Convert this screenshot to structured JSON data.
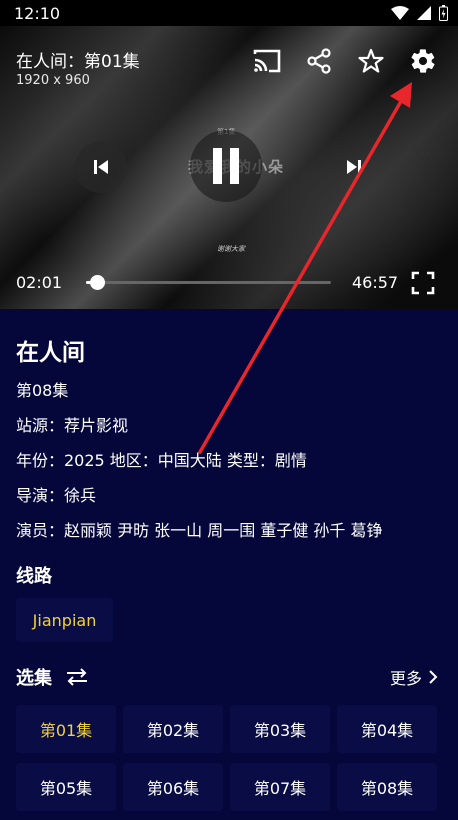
{
  "status": {
    "time": "12:10"
  },
  "player": {
    "title": "在人间：第01集",
    "resolution": "1920 x 960",
    "current_time": "02:01",
    "total_time": "46:57",
    "progress_fraction": 0.043,
    "frame_caption_top": "第1集",
    "frame_caption_main": "我爱我的小朵",
    "frame_caption_bottom": "谢谢大家"
  },
  "show": {
    "title": "在人间",
    "episode": "第08集",
    "source": "站源：荐片影视",
    "meta": "年份：2025  地区：中国大陆  类型：剧情",
    "director": "导演：徐兵",
    "cast": "演员：赵丽颖 尹昉 张一山 周一围 董子健 孙千 葛铮"
  },
  "lines": {
    "heading": "线路",
    "items": [
      "Jianpian"
    ]
  },
  "episodes": {
    "heading": "选集",
    "more_label": "更多",
    "items": [
      "第01集",
      "第02集",
      "第03集",
      "第04集",
      "第05集",
      "第06集",
      "第07集",
      "第08集"
    ],
    "active_index": 0
  },
  "colors": {
    "background": "#05073a",
    "chip": "#0a0d45",
    "accent": "#f2d13a",
    "annotation_arrow": "#e8262b"
  }
}
